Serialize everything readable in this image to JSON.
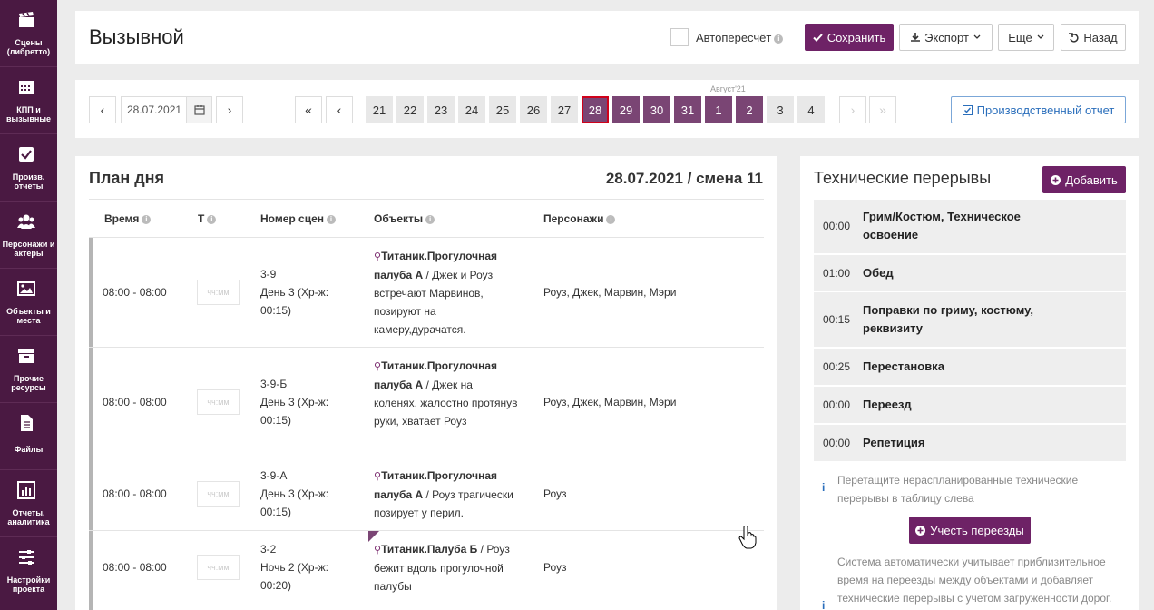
{
  "sidebar": {
    "items": [
      {
        "label": "Сцены\n(либретто)",
        "icon": "clapperboard-icon"
      },
      {
        "label": "КПП и\nвызывные",
        "icon": "calendar-icon"
      },
      {
        "label": "Произв.\nотчеты",
        "icon": "checkbox-icon"
      },
      {
        "label": "Персонажи и\nактеры",
        "icon": "users-icon"
      },
      {
        "label": "Объекты и\nместа",
        "icon": "image-icon"
      },
      {
        "label": "Прочие\nресурсы",
        "icon": "archive-icon"
      },
      {
        "label": "Файлы",
        "icon": "file-icon"
      },
      {
        "label": "Отчеты,\nаналитика",
        "icon": "bar-chart-icon"
      },
      {
        "label": "Настройки\nпроекта",
        "icon": "sliders-icon"
      }
    ]
  },
  "header": {
    "title": "Вызывной",
    "autorecalc_label": "Автопересчёт",
    "save_label": "Сохранить",
    "export_label": "Экспорт",
    "more_label": "Ещё",
    "back_label": "Назад"
  },
  "datebar": {
    "date_value": "28.07.2021",
    "month_label": "Август'21",
    "days": [
      "21",
      "22",
      "23",
      "24",
      "25",
      "26",
      "27",
      "28",
      "29",
      "30",
      "31",
      "1",
      "2",
      "3",
      "4"
    ],
    "selected_day": "28",
    "report_button": "Производственный отчет"
  },
  "plan": {
    "title": "План дня",
    "date_shift": "28.07.2021 / смена 11",
    "columns": {
      "time": "Время",
      "t": "Т",
      "scene": "Номер сцен",
      "objects": "Объекты",
      "characters": "Персонажи"
    },
    "time_placeholder": "чч:мм",
    "rows": [
      {
        "time": "08:00 - 08:00",
        "scene": "3-9",
        "day": "День 3 (Хр-ж: 00:15)",
        "location": "Титаник.Прогулочная палуба А",
        "description": " / Джек и Роуз встречают Марвинов, позируют на камеру,дурачатся.",
        "characters": "Роуз, Джек, Марвин, Мэри"
      },
      {
        "time": "08:00 - 08:00",
        "scene": "3-9-Б",
        "day": "День 3 (Хр-ж: 00:15)",
        "location": "Титаник.Прогулочная палуба А",
        "description": " / Джек на коленях, жалостно протянув руки, хватает Роуз",
        "characters": "Роуз, Джек, Марвин, Мэри"
      },
      {
        "time": "08:00 - 08:00",
        "scene": "3-9-А",
        "day": "День 3 (Хр-ж: 00:15)",
        "location": "Титаник.Прогулочная палуба А",
        "description": " / Роуз трагически позирует у перил.",
        "characters": "Роуз"
      },
      {
        "time": "08:00 - 08:00",
        "scene": "3-2",
        "day": "Ночь 2 (Хр-ж: 00:20)",
        "location": "Титаник.Палуба Б",
        "description": " / Роуз бежит вдоль прогулочной палубы",
        "characters": "Роуз"
      }
    ]
  },
  "tech_breaks": {
    "title": "Технические перерывы",
    "add_label": "Добавить",
    "items": [
      {
        "time": "00:00",
        "name": "Грим/Костюм, Техническое освоение"
      },
      {
        "time": "01:00",
        "name": "Обед"
      },
      {
        "time": "00:15",
        "name": "Поправки по гриму, костюму, реквизиту"
      },
      {
        "time": "00:25",
        "name": "Перестановка"
      },
      {
        "time": "00:00",
        "name": "Переезд"
      },
      {
        "time": "00:00",
        "name": "Репетиция"
      }
    ],
    "drag_note": "Перетащите нераспланированные технические перерывы в таблицу слева",
    "moves_button": "Учесть переезды",
    "auto_note": "Система автоматически учитывает приблизительное время на переезды между объектами и добавляет технические перерывы с учетом загруженности дорог."
  },
  "colors": {
    "sidebar": "#4a1942",
    "primary": "#6e2266",
    "day_purple": "#7a4574",
    "selected_border": "#d0021b",
    "info_blue": "#2a6ebb"
  }
}
